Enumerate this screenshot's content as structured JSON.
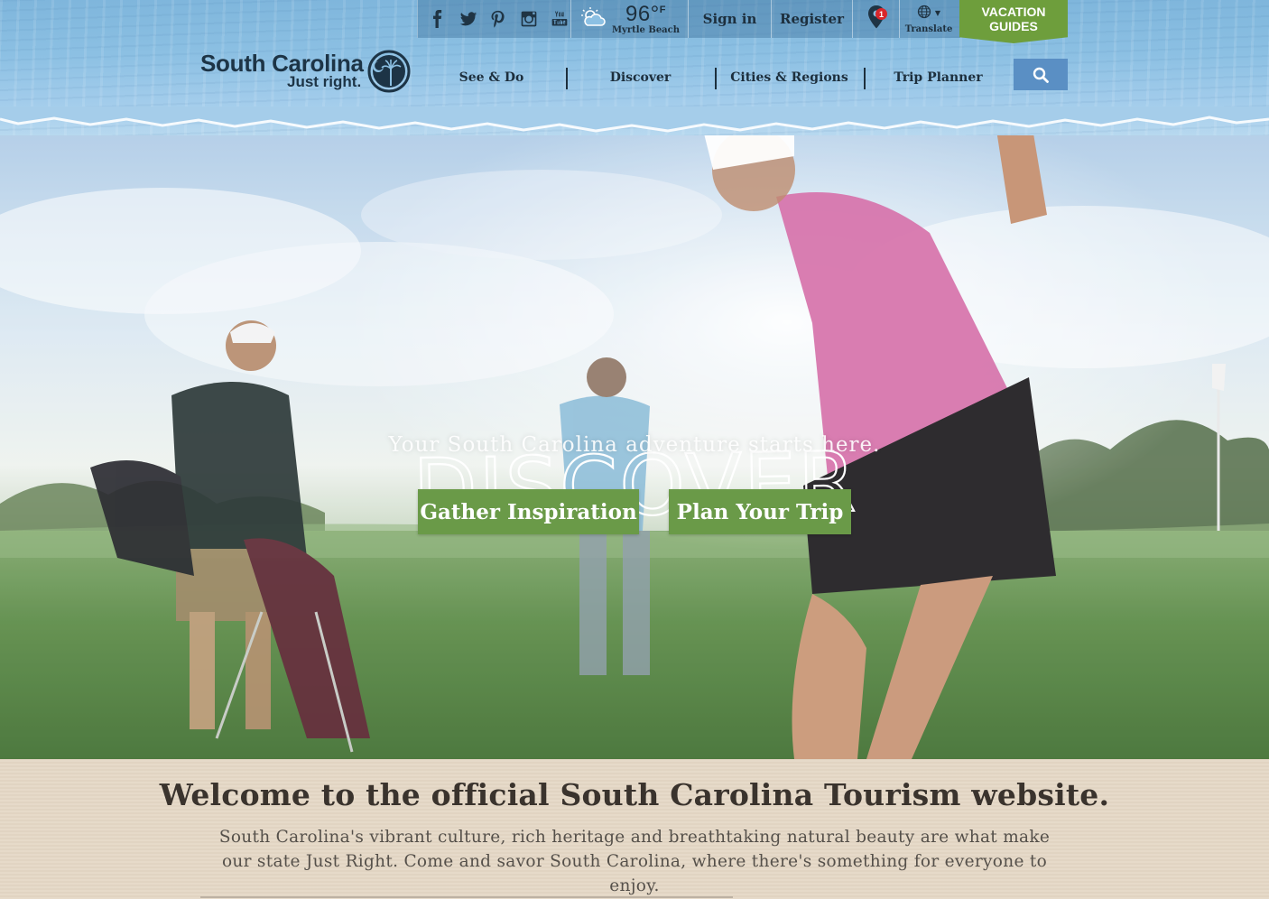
{
  "header": {
    "social": [
      "facebook-icon",
      "twitter-icon",
      "pinterest-icon",
      "instagram-icon",
      "youtube-icon"
    ],
    "weather": {
      "icon": "partly-cloudy-icon",
      "temperature": "96°",
      "unit": "F",
      "location": "Myrtle Beach"
    },
    "sign_in": "Sign in",
    "register": "Register",
    "favorites_count": "1",
    "translate": "Translate",
    "vacation_guides": {
      "line1": "VACATION",
      "line2": "GUIDES"
    },
    "logo": {
      "title": "South Carolina",
      "tagline": "Just right."
    },
    "nav": [
      {
        "label": "See & Do"
      },
      {
        "label": "Discover"
      },
      {
        "label": "Cities & Regions"
      },
      {
        "label": "Trip Planner"
      }
    ],
    "search_icon": "search-icon"
  },
  "hero": {
    "title": "DISCOVER",
    "subtitle": "Your South Carolina adventure starts here.",
    "buttons": {
      "inspiration": "Gather Inspiration",
      "plan": "Plan Your Trip"
    }
  },
  "welcome": {
    "title": "Welcome to the official South Carolina Tourism website.",
    "text": "South Carolina's vibrant culture, rich heritage and breathtaking natural beauty are what make our state Just Right. Come and savor South Carolina, where there's something for everyone to enjoy."
  },
  "colors": {
    "header_blue": "#8cc0e3",
    "accent_green": "#6e9e3c",
    "cta_green": "#6a9a48",
    "search_blue": "#5a8fc4",
    "welcome_bg": "#e5d8c6"
  }
}
